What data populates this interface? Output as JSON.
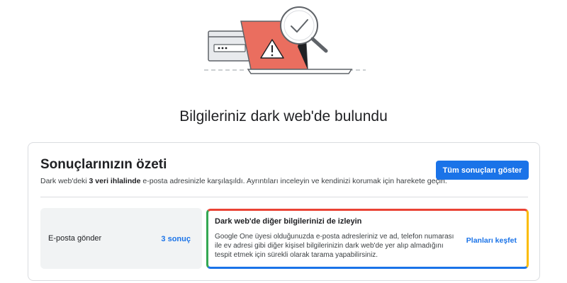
{
  "page": {
    "title": "Bilgileriniz dark web'de bulundu"
  },
  "illustration": {
    "icon": "laptop-warning-magnifier-illustration",
    "colors": {
      "screen": "#ea6e5f",
      "base": "#202124",
      "lens_check": "#5f6368"
    }
  },
  "summary": {
    "title": "Sonuçlarınızın özeti",
    "desc_prefix": "Dark web'deki ",
    "desc_bold": "3 veri ihlalinde",
    "desc_suffix": " e-posta adresinizle karşılaşıldı. Ayrıntıları inceleyin ve kendinizi korumak için harekete geçin.",
    "show_all_button": "Tüm sonuçları göster"
  },
  "email_result": {
    "label": "E-posta gönder",
    "count": "3 sonuç"
  },
  "promo": {
    "title": "Dark web'de diğer bilgilerinizi de izleyin",
    "body": "Google One üyesi olduğunuzda e-posta adresleriniz ve ad, telefon numarası ile ev adresi gibi diğer kişisel bilgilerinizin dark web'de yer alıp almadığını tespit etmek için sürekli olarak tarama yapabilirsiniz.",
    "link": "Planları keşfet"
  },
  "colors": {
    "accent": "#1a73e8",
    "text": "#202124",
    "border": "#dadce0",
    "google_red": "#ea4335",
    "google_yellow": "#fbbc04",
    "google_green": "#34a853",
    "google_blue": "#1a73e8"
  }
}
